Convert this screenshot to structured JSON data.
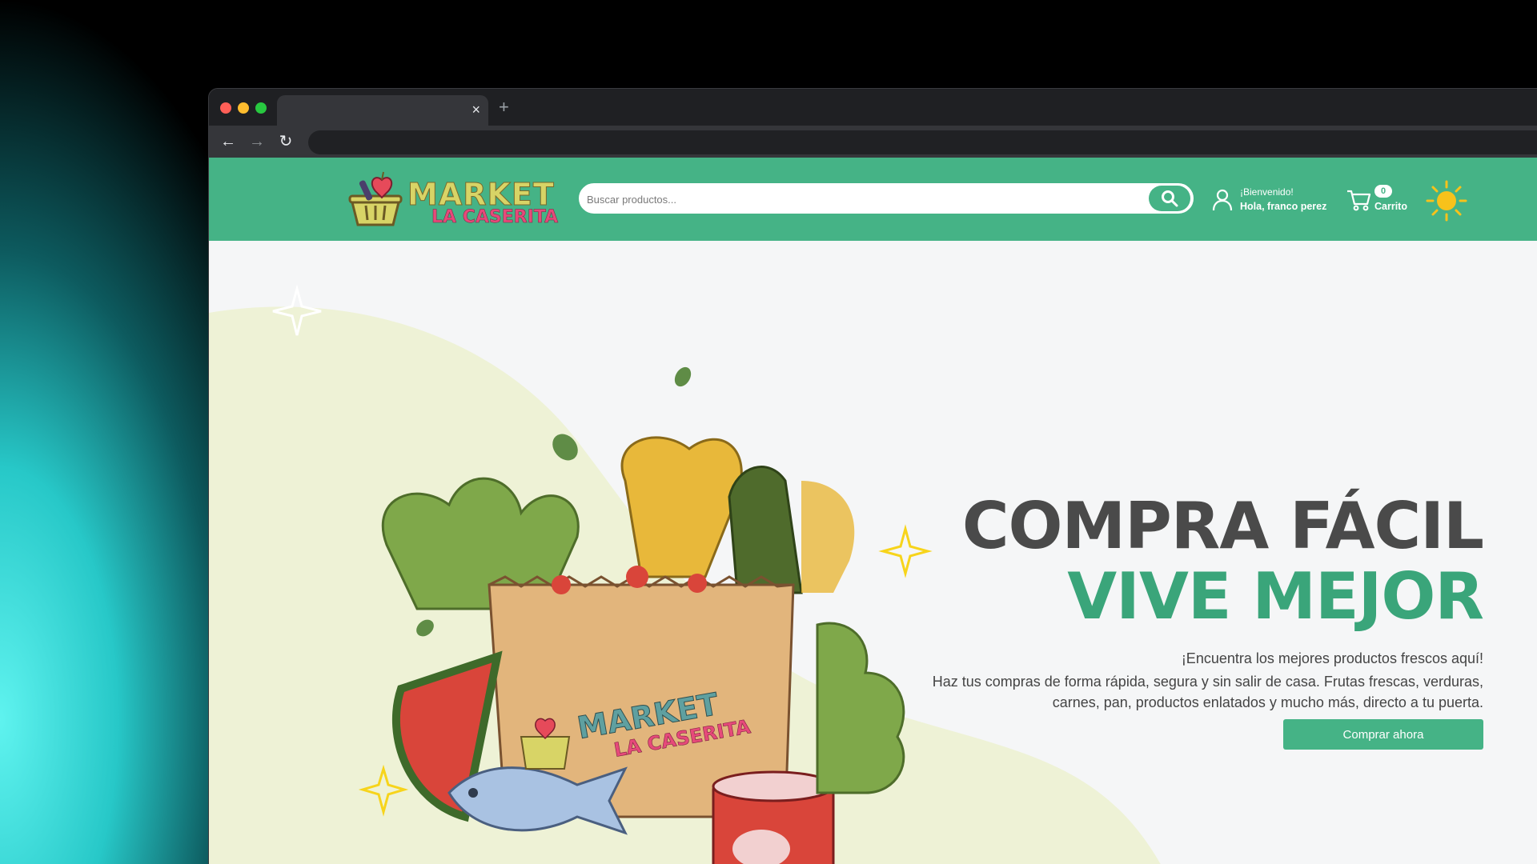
{
  "browser": {
    "tab_close": "×",
    "new_tab": "+",
    "back": "←",
    "forward": "→",
    "reload": "↻"
  },
  "header": {
    "logo_line1": "MARKET",
    "logo_line2": "LA CASERITA",
    "search_placeholder": "Buscar productos...",
    "greeting": "¡Bienvenido!",
    "user_name": "Hola, franco perez",
    "cart_count": "0",
    "cart_label": "Carrito"
  },
  "hero": {
    "title_line1": "COMPRA FÁCIL",
    "title_line2": "VIVE MEJOR",
    "lead": "¡Encuentra los mejores productos frescos aquí!",
    "body": "Haz tus compras de forma rápida, segura y sin salir de casa. Frutas frescas, verduras, carnes, pan, productos enlatados y mucho más, directo a tu puerta.",
    "cta": "Comprar ahora",
    "bag_logo_line1": "MARKET",
    "bag_logo_line2": "LA CASERITA"
  },
  "colors": {
    "brand_green": "#45b386",
    "title_green": "#3aa57a",
    "title_dark": "#4a4a4a",
    "logo_yellow": "#d8d466",
    "logo_pink": "#e64a7a"
  }
}
